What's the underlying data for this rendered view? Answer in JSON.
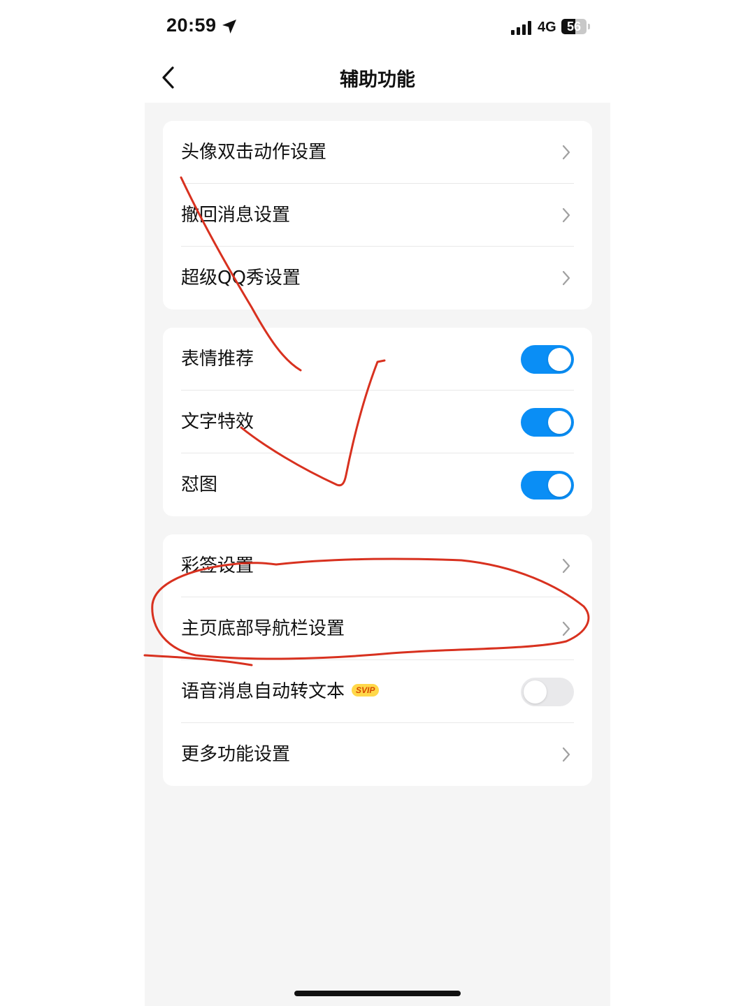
{
  "status_bar": {
    "time": "20:59",
    "network": "4G",
    "battery": "56",
    "battery_level": 0.56
  },
  "header": {
    "title": "辅助功能"
  },
  "groups": [
    {
      "items": [
        {
          "label": "头像双击动作设置",
          "control": "chevron"
        },
        {
          "label": "撤回消息设置",
          "control": "chevron"
        },
        {
          "label": "超级QQ秀设置",
          "control": "chevron"
        }
      ]
    },
    {
      "items": [
        {
          "label": "表情推荐",
          "control": "toggle",
          "enabled": true
        },
        {
          "label": "文字特效",
          "control": "toggle",
          "enabled": true
        },
        {
          "label": "怼图",
          "control": "toggle",
          "enabled": true
        }
      ]
    },
    {
      "items": [
        {
          "label": "彩签设置",
          "control": "chevron"
        },
        {
          "label": "主页底部导航栏设置",
          "control": "chevron"
        },
        {
          "label": "语音消息自动转文本",
          "badge": "SVIP",
          "control": "toggle",
          "enabled": false
        },
        {
          "label": "更多功能设置",
          "control": "chevron"
        }
      ]
    }
  ],
  "colors": {
    "toggle_on": "#0a8ef5",
    "toggle_off": "#e9e9eb",
    "annotation_ink": "#d8311f"
  }
}
